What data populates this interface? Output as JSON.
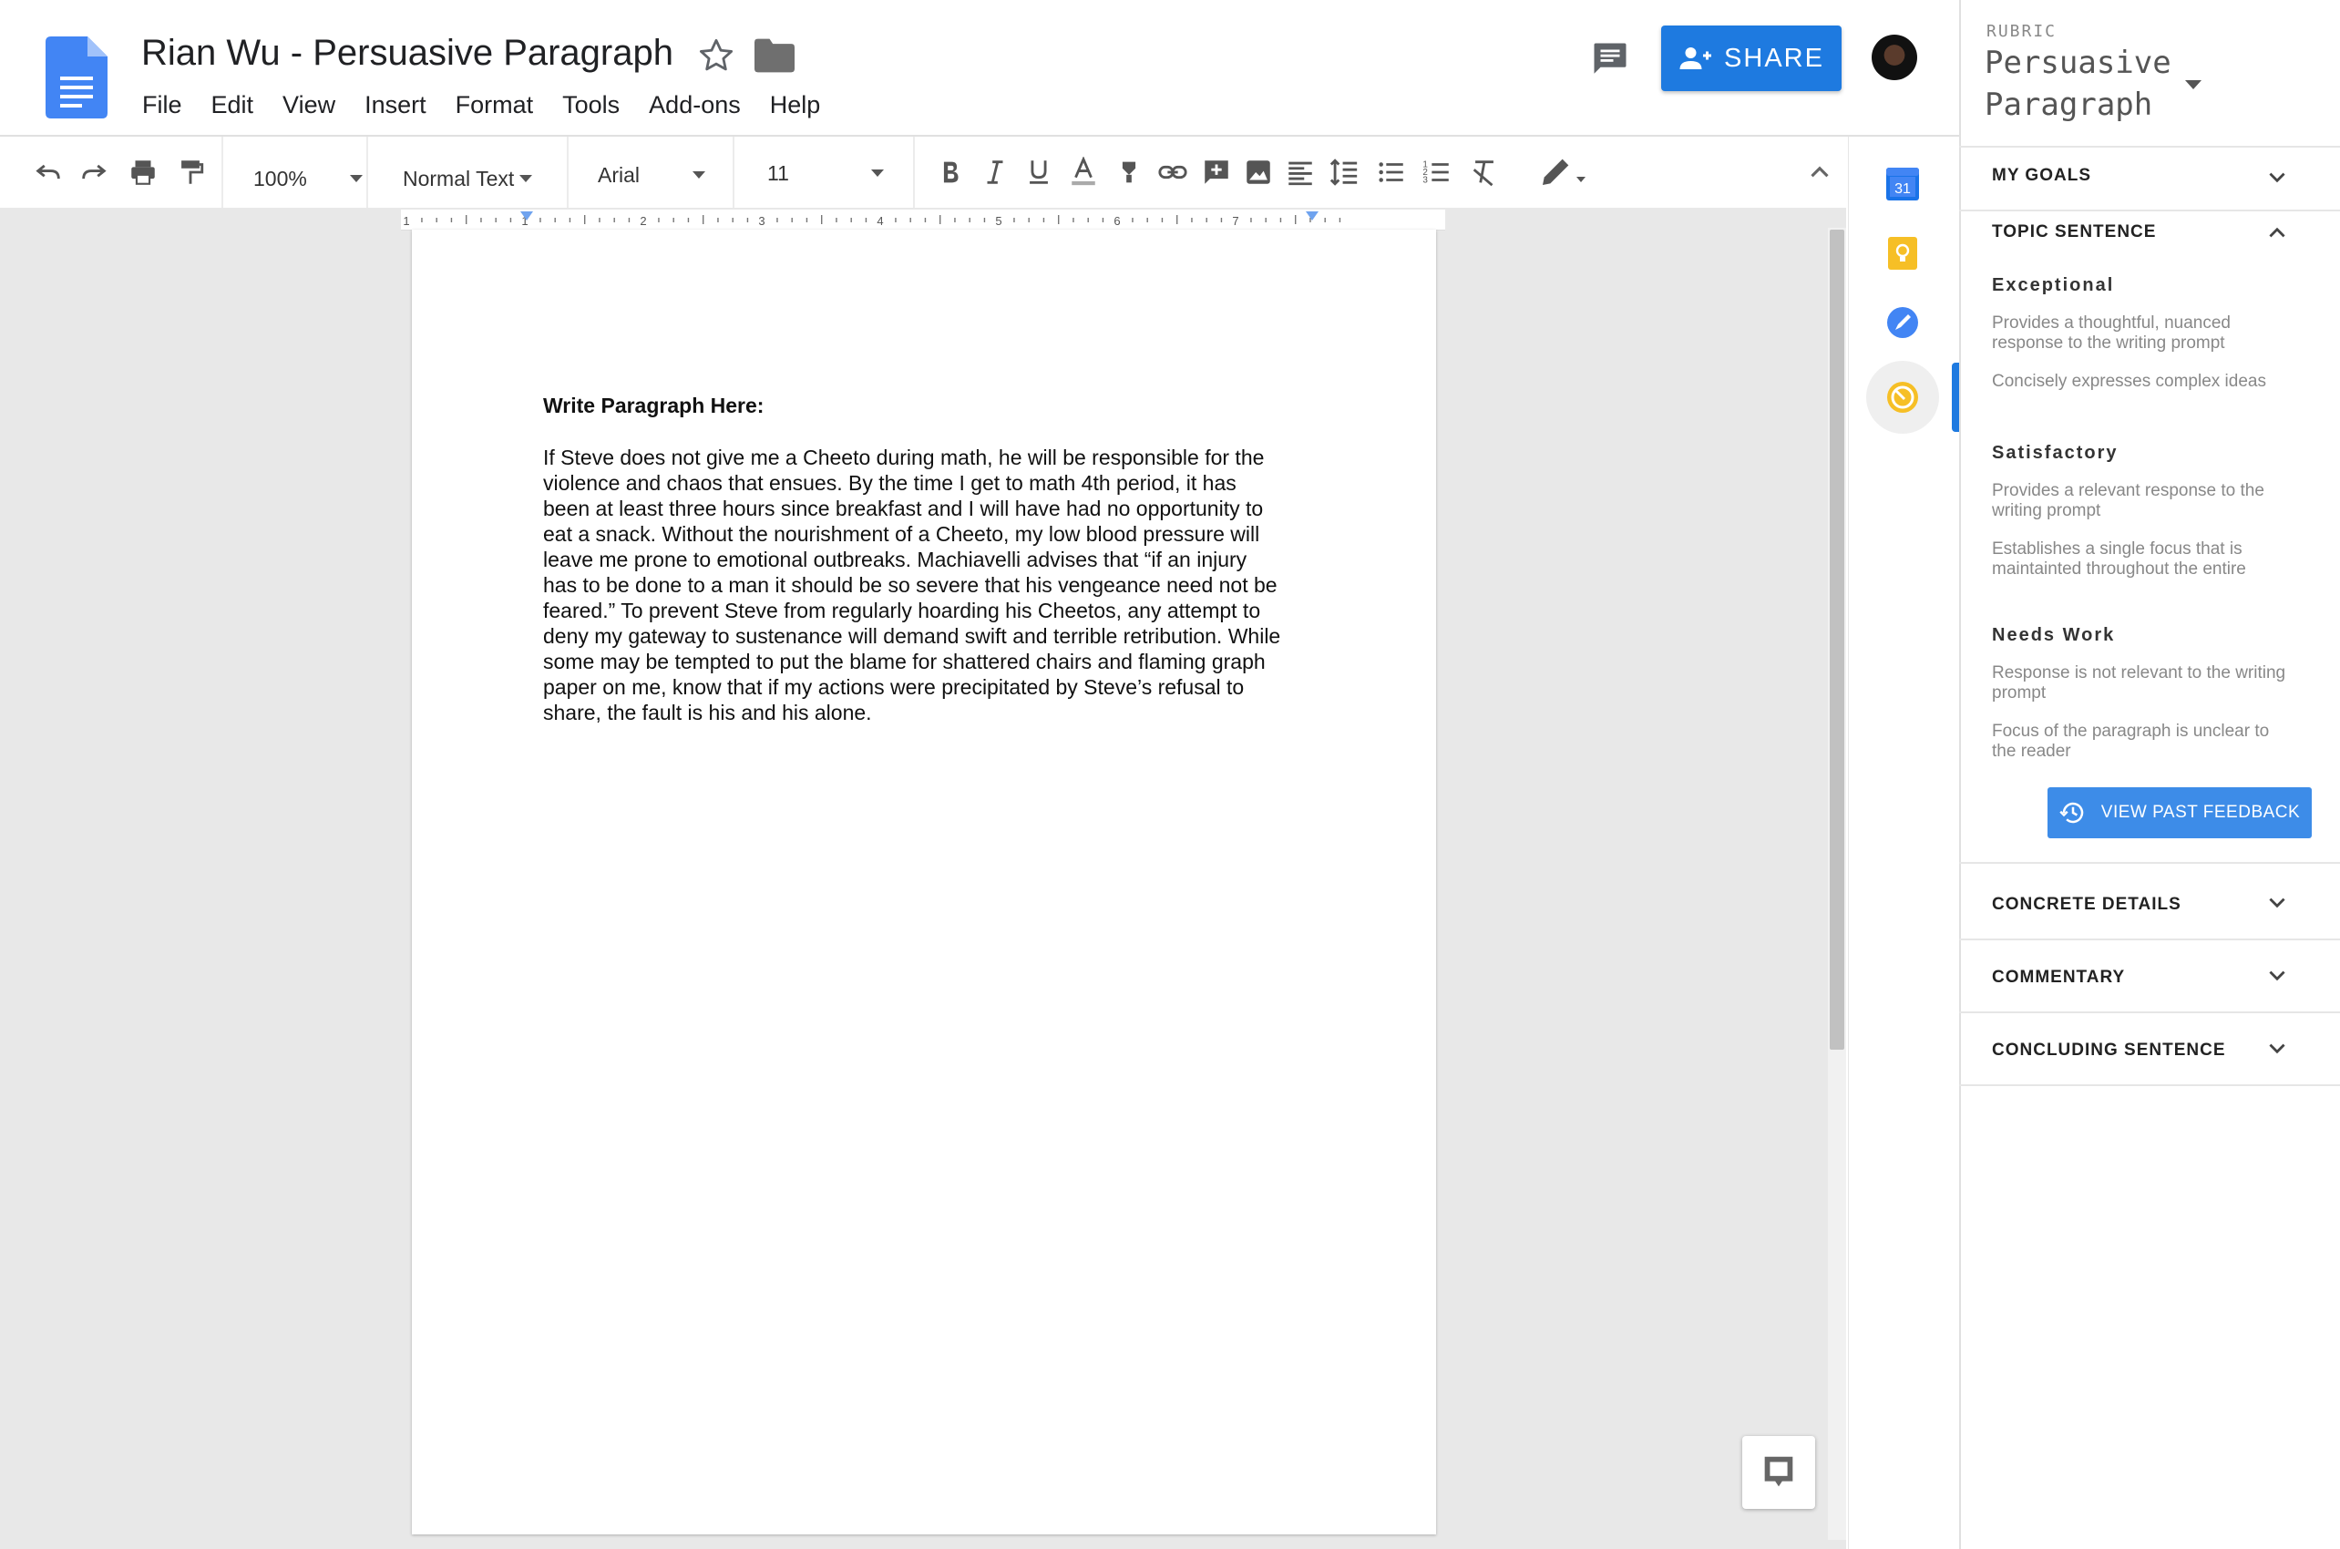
{
  "header": {
    "doc_title": "Rian Wu - Persuasive Paragraph",
    "share_label": "SHARE",
    "menu": [
      "File",
      "Edit",
      "View",
      "Insert",
      "Format",
      "Tools",
      "Add-ons",
      "Help"
    ]
  },
  "toolbar": {
    "zoom": "100%",
    "style": "Normal Text",
    "font": "Arial",
    "size": "11"
  },
  "ruler": {
    "marks": [
      "1",
      "1",
      "2",
      "3",
      "4",
      "5",
      "6",
      "7"
    ]
  },
  "document": {
    "heading": "Write Paragraph Here:",
    "lines": [
      "If Steve does not give me a Cheeto during math, he will be responsible for the",
      "violence and chaos that ensues. By the time I get to math 4th period, it has",
      "been at least three hours since breakfast and I will have had no opportunity to",
      "eat a snack. Without the nourishment of a Cheeto, my low blood pressure will",
      "leave me prone to emotional outbreaks. Machiavelli advises that “if an injury",
      "has to be done to a man it should be so severe that his vengeance need not be",
      "feared.” To prevent Steve from regularly hoarding his Cheetos, any attempt to",
      "deny my gateway to sustenance will demand swift and terrible retribution. While",
      "some may be tempted to put the blame for shattered chairs and flaming graph",
      "paper on me, know that if my actions were precipitated by Steve’s refusal to",
      "share, the fault is his and his alone."
    ]
  },
  "addons": {
    "calendar_day": "31"
  },
  "rubric": {
    "label": "RUBRIC",
    "title": "Persuasive Paragraph",
    "sections": {
      "my_goals": "MY GOALS",
      "topic_sentence": "TOPIC SENTENCE",
      "concrete_details": "CONCRETE DETAILS",
      "commentary": "COMMENTARY",
      "concluding_sentence": "CONCLUDING SENTENCE"
    },
    "levels": [
      {
        "name": "Exceptional",
        "criteria": [
          "Provides a thoughtful, nuanced response to the writing prompt",
          "Concisely expresses complex ideas"
        ]
      },
      {
        "name": "Satisfactory",
        "criteria": [
          "Provides a relevant response to the writing prompt",
          "Establishes a single focus that is maintainted throughout the entire"
        ]
      },
      {
        "name": "Needs Work",
        "criteria": [
          "Response is not relevant to the writing prompt",
          "Focus of the paragraph is unclear to the reader"
        ]
      }
    ],
    "view_past_feedback": "VIEW PAST FEEDBACK"
  },
  "colors": {
    "accent_blue": "#1e7ae0",
    "button_blue": "#3d8ce8",
    "docs_blue": "#4285f4",
    "keep_yellow": "#f6bf26"
  }
}
